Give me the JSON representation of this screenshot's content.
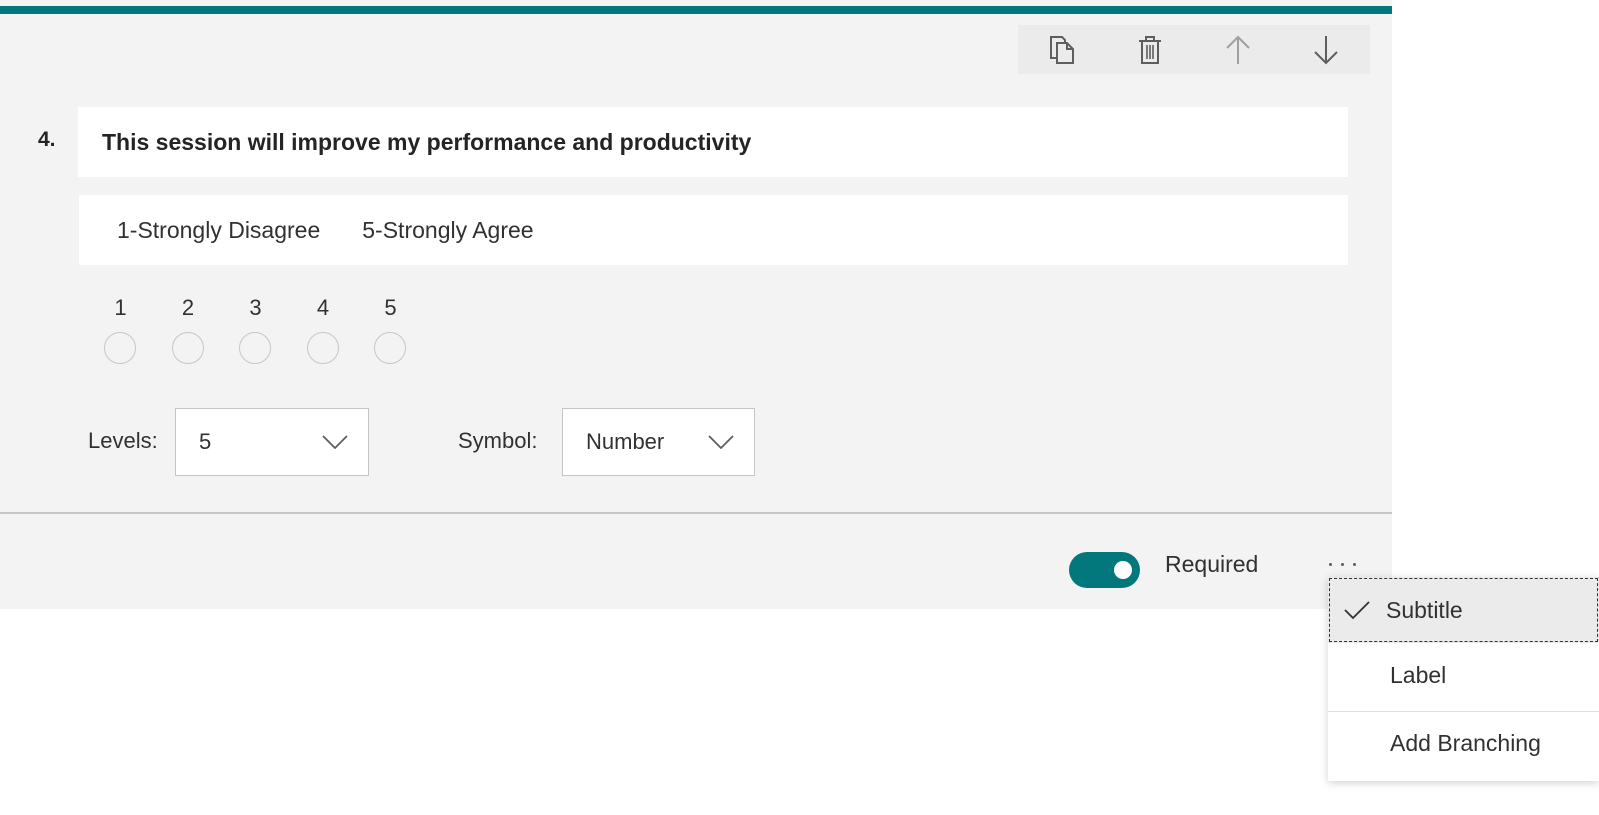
{
  "question": {
    "number": "4.",
    "title": "This session will improve my performance and productivity",
    "subtitle_low": "1-Strongly Disagree",
    "subtitle_high": "5-Strongly Agree",
    "scale": [
      "1",
      "2",
      "3",
      "4",
      "5"
    ]
  },
  "toolbar": {
    "icons": [
      "copy-icon",
      "delete-icon",
      "arrow-up-icon",
      "arrow-down-icon"
    ]
  },
  "settings": {
    "levels_label": "Levels:",
    "levels_value": "5",
    "symbol_label": "Symbol:",
    "symbol_value": "Number"
  },
  "footer": {
    "required_label": "Required",
    "required_on": true
  },
  "menu": {
    "items": [
      {
        "label": "Subtitle",
        "checked": true
      },
      {
        "label": "Label",
        "checked": false
      },
      {
        "label": "Add Branching",
        "checked": false
      }
    ]
  },
  "colors": {
    "accent": "#03787c",
    "card_bg": "#f3f3f3"
  }
}
